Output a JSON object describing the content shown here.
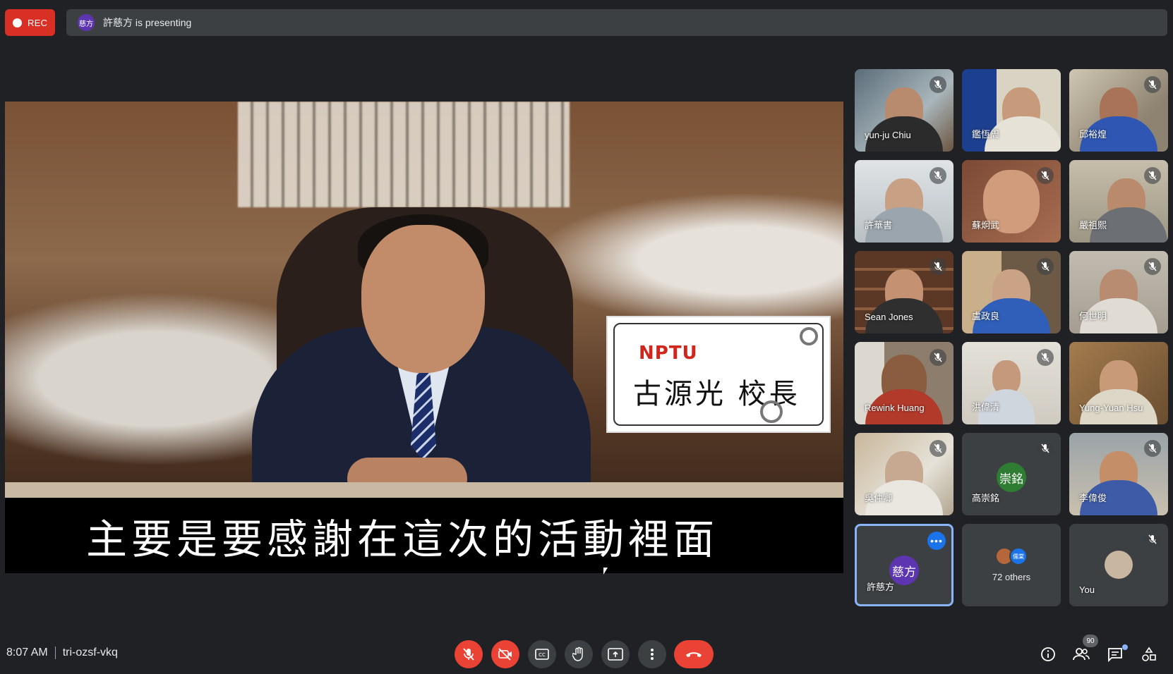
{
  "top_bar": {
    "rec_label": "REC",
    "presenter_avatar": "慈方",
    "presenting_text": "許慈方 is presenting"
  },
  "presentation": {
    "logo_text": "NPTU",
    "name_card": "古源光 校長",
    "subtitle": "主要是要感謝在這次的活動裡面"
  },
  "participants": [
    {
      "name": "yun-ju Chiu",
      "muted": true
    },
    {
      "name": "鑑恆周",
      "muted": false
    },
    {
      "name": "邱裕煌",
      "muted": true
    },
    {
      "name": "許華書",
      "muted": true
    },
    {
      "name": "蘇炯武",
      "muted": true
    },
    {
      "name": "嚴祖熙",
      "muted": true
    },
    {
      "name": "Sean Jones",
      "muted": true
    },
    {
      "name": "盧政良",
      "muted": true
    },
    {
      "name": "何世明",
      "muted": true
    },
    {
      "name": "Rewink Huang",
      "muted": true
    },
    {
      "name": "洪偉清",
      "muted": true
    },
    {
      "name": "Yung-Yuan Hsu",
      "muted": false
    },
    {
      "name": "吳仲卿",
      "muted": true
    },
    {
      "name": "高崇銘",
      "avatar": "崇銘",
      "muted": true
    },
    {
      "name": "李偉俊",
      "muted": true
    },
    {
      "name": "許慈方",
      "avatar": "慈方",
      "muted": false
    },
    {
      "name": "72 others",
      "avatars": [
        "",
        "儒棠"
      ]
    },
    {
      "name": "You",
      "muted": true
    }
  ],
  "bottom_bar": {
    "time": "8:07 AM",
    "meeting_code": "tri-ozsf-vkq",
    "participant_count": "90"
  },
  "colors": {
    "background": "#202124",
    "tile": "#3c4043",
    "danger": "#ea4335",
    "accent": "#8ab4f8"
  }
}
